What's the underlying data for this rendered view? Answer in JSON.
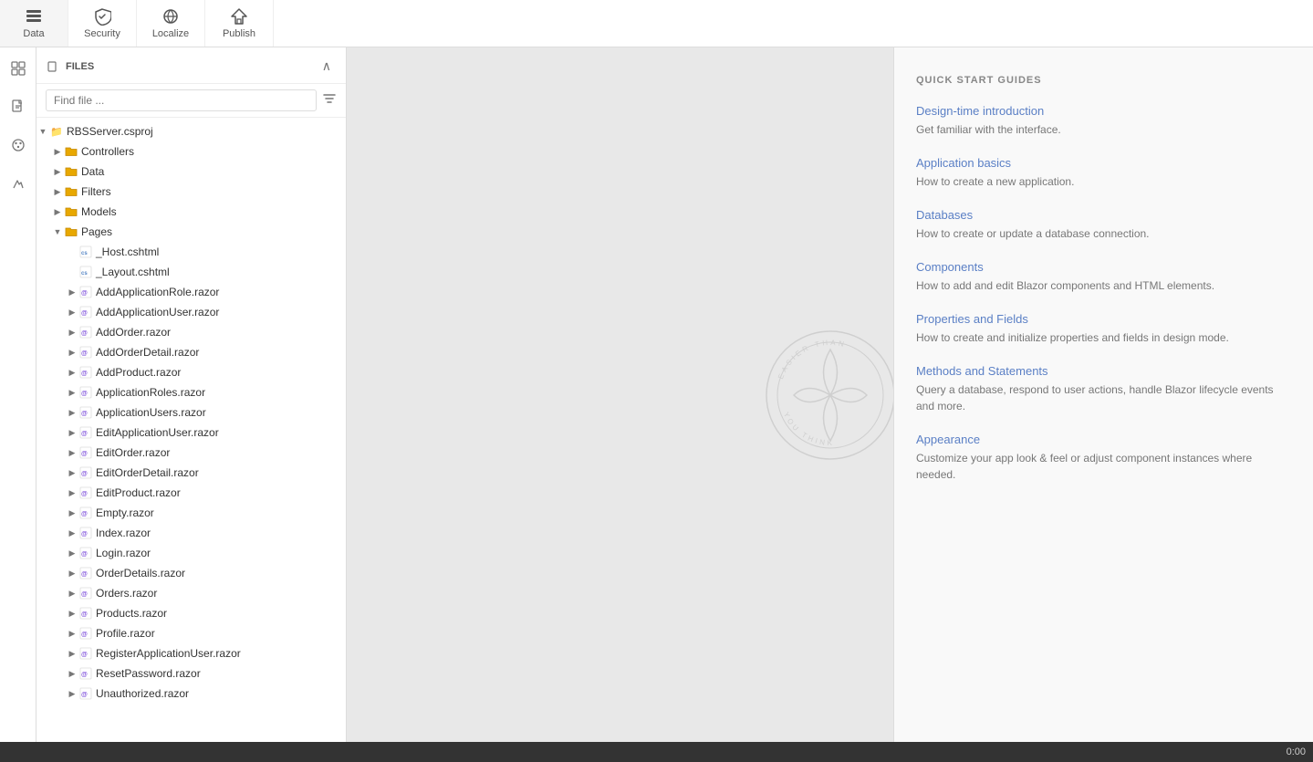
{
  "toolbar": {
    "items": [
      {
        "id": "data",
        "label": "Data",
        "icon": "⊞"
      },
      {
        "id": "security",
        "label": "Security",
        "icon": "🔒"
      },
      {
        "id": "localize",
        "label": "Localize",
        "icon": "✦"
      },
      {
        "id": "publish",
        "label": "Publish",
        "icon": "🚀"
      }
    ]
  },
  "file_panel": {
    "title": "FILES",
    "search_placeholder": "Find file ...",
    "tree": [
      {
        "level": 0,
        "type": "project",
        "label": "RBSServer.csproj",
        "expanded": true,
        "arrow": "▼"
      },
      {
        "level": 1,
        "type": "folder",
        "label": "Controllers",
        "expanded": false,
        "arrow": "▶"
      },
      {
        "level": 1,
        "type": "folder",
        "label": "Data",
        "expanded": false,
        "arrow": "▶"
      },
      {
        "level": 1,
        "type": "folder",
        "label": "Filters",
        "expanded": false,
        "arrow": "▶"
      },
      {
        "level": 1,
        "type": "folder",
        "label": "Models",
        "expanded": false,
        "arrow": "▶"
      },
      {
        "level": 1,
        "type": "folder",
        "label": "Pages",
        "expanded": true,
        "arrow": "▼"
      },
      {
        "level": 2,
        "type": "cshtml",
        "label": "_Host.cshtml",
        "arrow": ""
      },
      {
        "level": 2,
        "type": "cshtml",
        "label": "_Layout.cshtml",
        "arrow": ""
      },
      {
        "level": 2,
        "type": "razor",
        "label": "AddApplicationRole.razor",
        "arrow": "▶"
      },
      {
        "level": 2,
        "type": "razor",
        "label": "AddApplicationUser.razor",
        "arrow": "▶"
      },
      {
        "level": 2,
        "type": "razor",
        "label": "AddOrder.razor",
        "arrow": "▶"
      },
      {
        "level": 2,
        "type": "razor",
        "label": "AddOrderDetail.razor",
        "arrow": "▶"
      },
      {
        "level": 2,
        "type": "razor",
        "label": "AddProduct.razor",
        "arrow": "▶"
      },
      {
        "level": 2,
        "type": "razor",
        "label": "ApplicationRoles.razor",
        "arrow": "▶"
      },
      {
        "level": 2,
        "type": "razor",
        "label": "ApplicationUsers.razor",
        "arrow": "▶"
      },
      {
        "level": 2,
        "type": "razor",
        "label": "EditApplicationUser.razor",
        "arrow": "▶"
      },
      {
        "level": 2,
        "type": "razor",
        "label": "EditOrder.razor",
        "arrow": "▶"
      },
      {
        "level": 2,
        "type": "razor",
        "label": "EditOrderDetail.razor",
        "arrow": "▶"
      },
      {
        "level": 2,
        "type": "razor",
        "label": "EditProduct.razor",
        "arrow": "▶"
      },
      {
        "level": 2,
        "type": "razor",
        "label": "Empty.razor",
        "arrow": "▶"
      },
      {
        "level": 2,
        "type": "razor",
        "label": "Index.razor",
        "arrow": "▶"
      },
      {
        "level": 2,
        "type": "razor",
        "label": "Login.razor",
        "arrow": "▶"
      },
      {
        "level": 2,
        "type": "razor",
        "label": "OrderDetails.razor",
        "arrow": "▶"
      },
      {
        "level": 2,
        "type": "razor",
        "label": "Orders.razor",
        "arrow": "▶"
      },
      {
        "level": 2,
        "type": "razor",
        "label": "Products.razor",
        "arrow": "▶"
      },
      {
        "level": 2,
        "type": "razor",
        "label": "Profile.razor",
        "arrow": "▶"
      },
      {
        "level": 2,
        "type": "razor",
        "label": "RegisterApplicationUser.razor",
        "arrow": "▶"
      },
      {
        "level": 2,
        "type": "razor",
        "label": "ResetPassword.razor",
        "arrow": "▶"
      },
      {
        "level": 2,
        "type": "razor",
        "label": "Unauthorized.razor",
        "arrow": "▶"
      }
    ]
  },
  "quick_start": {
    "section_title": "QUICK START GUIDES",
    "guides": [
      {
        "id": "design-time",
        "title": "Design-time introduction",
        "description": "Get familiar with the interface."
      },
      {
        "id": "app-basics",
        "title": "Application basics",
        "description": "How to create a new application."
      },
      {
        "id": "databases",
        "title": "Databases",
        "description": "How to create or update a database connection."
      },
      {
        "id": "components",
        "title": "Components",
        "description": "How to add and edit Blazor components and HTML elements."
      },
      {
        "id": "properties-fields",
        "title": "Properties and Fields",
        "description": "How to create and initialize properties and fields in design mode."
      },
      {
        "id": "methods-statements",
        "title": "Methods and Statements",
        "description": "Query a database, respond to user actions, handle Blazor lifecycle events and more."
      },
      {
        "id": "appearance",
        "title": "Appearance",
        "description": "Customize your app look & feel or adjust component instances where needed."
      }
    ]
  },
  "status_bar": {
    "text": "0:00"
  }
}
